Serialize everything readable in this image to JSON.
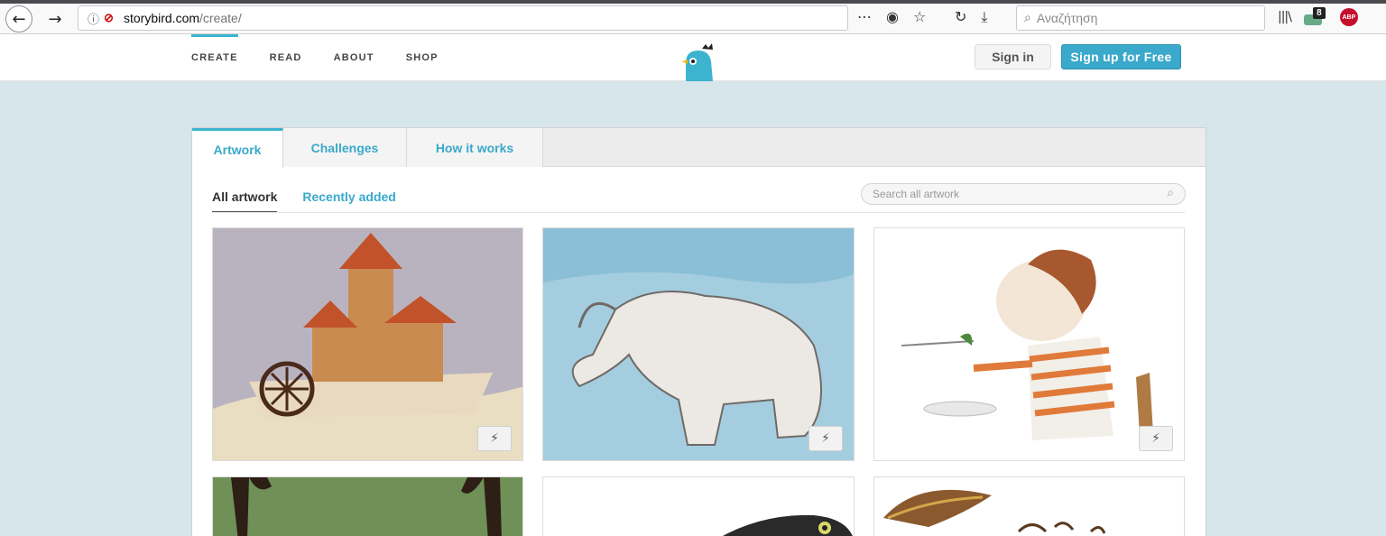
{
  "browser": {
    "url_domain": "storybird.com",
    "url_path": "/create/",
    "search_placeholder": "Αναζήτηση",
    "extension_badge": "8",
    "abp_label": "ABP"
  },
  "site": {
    "nav": [
      {
        "label": "CREATE",
        "active": true
      },
      {
        "label": "READ"
      },
      {
        "label": "ABOUT"
      },
      {
        "label": "SHOP"
      }
    ],
    "sign_in": "Sign in",
    "sign_up": "Sign up for Free",
    "brand_color": "#3aa9cb"
  },
  "panel": {
    "tabs": [
      {
        "label": "Artwork",
        "active": true
      },
      {
        "label": "Challenges"
      },
      {
        "label": "How it works"
      }
    ],
    "subtabs": [
      {
        "label": "All artwork",
        "active": true
      },
      {
        "label": "Recently added"
      }
    ],
    "search_placeholder": "Search all artwork"
  },
  "artworks": [
    {
      "icon": "castle-boat-illustration"
    },
    {
      "icon": "elephant-illustration"
    },
    {
      "icon": "boy-eating-illustration"
    },
    {
      "icon": "trees-illustration"
    },
    {
      "icon": "black-bird-illustration"
    },
    {
      "icon": "umbrella-illustration"
    }
  ]
}
